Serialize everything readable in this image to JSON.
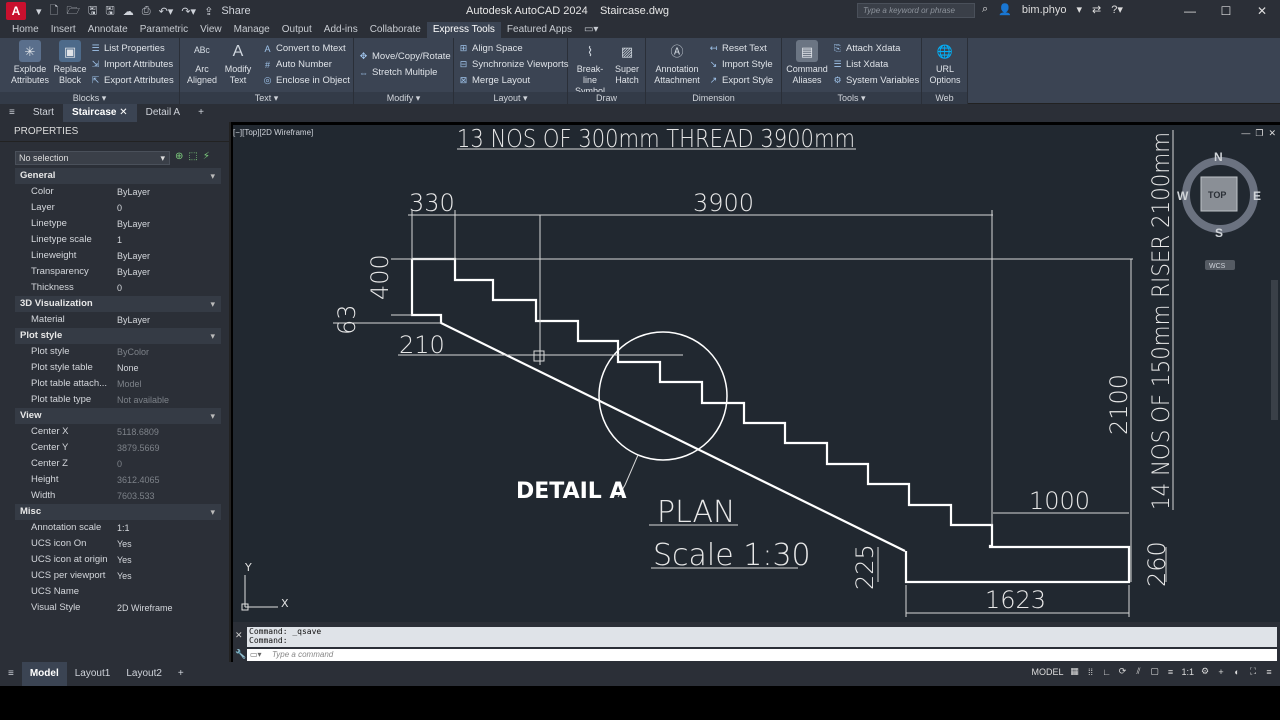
{
  "titlebar": {
    "logo": "A",
    "share": "Share",
    "title": "Autodesk AutoCAD 2024",
    "file": "Staircase.dwg",
    "search_placeholder": "Type a keyword or phrase",
    "user": "bim.phyo"
  },
  "ribbon_tabs": [
    "Home",
    "Insert",
    "Annotate",
    "Parametric",
    "View",
    "Manage",
    "Output",
    "Add-ins",
    "Collaborate",
    "Express Tools",
    "Featured Apps"
  ],
  "ribbon": {
    "blocks": {
      "explode": "Explode Attributes",
      "replace": "Replace Block",
      "list_props": "List Properties",
      "import_attr": "Import Attributes",
      "export_attr": "Export Attributes",
      "label": "Blocks"
    },
    "text": {
      "arc": "Arc Aligned",
      "modify": "Modify Text",
      "convert": "Convert to Mtext",
      "auto_num": "Auto Number",
      "enclose": "Enclose in Object",
      "label": "Text"
    },
    "modify": {
      "move": "Move/Copy/Rotate",
      "stretch": "Stretch Multiple",
      "label": "Modify"
    },
    "layout": {
      "align": "Align Space",
      "sync": "Synchronize Viewports",
      "merge": "Merge Layout",
      "label": "Layout"
    },
    "draw": {
      "breakline": "Break-line Symbol",
      "superhatch": "Super Hatch",
      "label": "Draw"
    },
    "dimension": {
      "annot": "Annotation Attachment",
      "reset": "Reset Text",
      "import": "Import Style",
      "export": "Export Style",
      "label": "Dimension"
    },
    "tools": {
      "cmd": "Command Aliases",
      "attach": "Attach Xdata",
      "list": "List Xdata",
      "sysvar": "System Variables",
      "label": "Tools"
    },
    "web": {
      "url": "URL Options",
      "label": "Web"
    }
  },
  "doc_tabs": [
    "Start",
    "Staircase",
    "Detail A"
  ],
  "properties": {
    "title": "PROPERTIES",
    "selection": "No selection",
    "sections": [
      {
        "name": "General",
        "rows": [
          [
            "Color",
            "ByLayer"
          ],
          [
            "Layer",
            "0"
          ],
          [
            "Linetype",
            "ByLayer"
          ],
          [
            "Linetype scale",
            "1"
          ],
          [
            "Lineweight",
            "ByLayer"
          ],
          [
            "Transparency",
            "ByLayer"
          ],
          [
            "Thickness",
            "0"
          ]
        ]
      },
      {
        "name": "3D Visualization",
        "rows": [
          [
            "Material",
            "ByLayer"
          ]
        ]
      },
      {
        "name": "Plot style",
        "rows": [
          [
            "Plot style",
            "ByColor"
          ],
          [
            "Plot style table",
            "None"
          ],
          [
            "Plot table attach...",
            "Model"
          ],
          [
            "Plot table type",
            "Not available"
          ]
        ]
      },
      {
        "name": "View",
        "rows": [
          [
            "Center X",
            "5118.6809"
          ],
          [
            "Center Y",
            "3879.5669"
          ],
          [
            "Center Z",
            "0"
          ],
          [
            "Height",
            "3612.4065"
          ],
          [
            "Width",
            "7603.533"
          ]
        ]
      },
      {
        "name": "Misc",
        "rows": [
          [
            "Annotation scale",
            "1:1"
          ],
          [
            "UCS icon On",
            "Yes"
          ],
          [
            "UCS icon at origin",
            "Yes"
          ],
          [
            "UCS per viewport",
            "Yes"
          ],
          [
            "UCS Name",
            ""
          ],
          [
            "Visual Style",
            "2D Wireframe"
          ]
        ]
      }
    ]
  },
  "viewport": {
    "label": "[−][Top][2D Wireframe]"
  },
  "drawing": {
    "title_text": "13 NOS OF 300mm THREAD 3900mm",
    "riser_text": "14 NOS OF 150mm RISER 2100mm",
    "dim_330": "330",
    "dim_3900": "3900",
    "dim_400": "400",
    "dim_63": "63",
    "dim_210": "210",
    "dim_2100": "2100",
    "dim_1000": "1000",
    "dim_225": "225",
    "dim_260": "260",
    "dim_1623": "1623",
    "detail_label": "DETAIL A",
    "plan": "PLAN",
    "scale": "Scale 1:30",
    "axis_y": "Y",
    "axis_x": "X"
  },
  "viewcube": {
    "n": "N",
    "s": "S",
    "e": "E",
    "w": "W",
    "top": "TOP",
    "wcs": "WCS"
  },
  "command": {
    "line1": "Command: _qsave",
    "line2": "Command:",
    "placeholder": "Type a command"
  },
  "layout_tabs": [
    "Model",
    "Layout1",
    "Layout2"
  ],
  "status": {
    "model": "MODEL",
    "scale": "1:1"
  }
}
